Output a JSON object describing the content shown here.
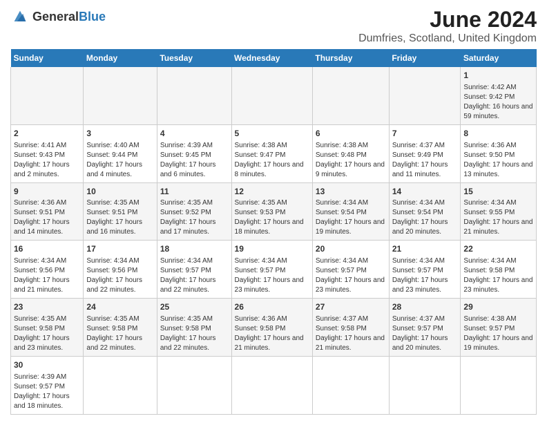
{
  "header": {
    "logo_general": "General",
    "logo_blue": "Blue",
    "title": "June 2024",
    "subtitle": "Dumfries, Scotland, United Kingdom"
  },
  "columns": [
    "Sunday",
    "Monday",
    "Tuesday",
    "Wednesday",
    "Thursday",
    "Friday",
    "Saturday"
  ],
  "weeks": [
    {
      "days": [
        {
          "num": "",
          "detail": ""
        },
        {
          "num": "",
          "detail": ""
        },
        {
          "num": "",
          "detail": ""
        },
        {
          "num": "",
          "detail": ""
        },
        {
          "num": "",
          "detail": ""
        },
        {
          "num": "",
          "detail": ""
        },
        {
          "num": "1",
          "detail": "Sunrise: 4:42 AM\nSunset: 9:42 PM\nDaylight: 16 hours and 59 minutes."
        }
      ]
    },
    {
      "days": [
        {
          "num": "2",
          "detail": "Sunrise: 4:41 AM\nSunset: 9:43 PM\nDaylight: 17 hours and 2 minutes."
        },
        {
          "num": "3",
          "detail": "Sunrise: 4:40 AM\nSunset: 9:44 PM\nDaylight: 17 hours and 4 minutes."
        },
        {
          "num": "4",
          "detail": "Sunrise: 4:39 AM\nSunset: 9:45 PM\nDaylight: 17 hours and 6 minutes."
        },
        {
          "num": "5",
          "detail": "Sunrise: 4:38 AM\nSunset: 9:47 PM\nDaylight: 17 hours and 8 minutes."
        },
        {
          "num": "6",
          "detail": "Sunrise: 4:38 AM\nSunset: 9:48 PM\nDaylight: 17 hours and 9 minutes."
        },
        {
          "num": "7",
          "detail": "Sunrise: 4:37 AM\nSunset: 9:49 PM\nDaylight: 17 hours and 11 minutes."
        },
        {
          "num": "8",
          "detail": "Sunrise: 4:36 AM\nSunset: 9:50 PM\nDaylight: 17 hours and 13 minutes."
        }
      ]
    },
    {
      "days": [
        {
          "num": "9",
          "detail": "Sunrise: 4:36 AM\nSunset: 9:51 PM\nDaylight: 17 hours and 14 minutes."
        },
        {
          "num": "10",
          "detail": "Sunrise: 4:35 AM\nSunset: 9:51 PM\nDaylight: 17 hours and 16 minutes."
        },
        {
          "num": "11",
          "detail": "Sunrise: 4:35 AM\nSunset: 9:52 PM\nDaylight: 17 hours and 17 minutes."
        },
        {
          "num": "12",
          "detail": "Sunrise: 4:35 AM\nSunset: 9:53 PM\nDaylight: 17 hours and 18 minutes."
        },
        {
          "num": "13",
          "detail": "Sunrise: 4:34 AM\nSunset: 9:54 PM\nDaylight: 17 hours and 19 minutes."
        },
        {
          "num": "14",
          "detail": "Sunrise: 4:34 AM\nSunset: 9:54 PM\nDaylight: 17 hours and 20 minutes."
        },
        {
          "num": "15",
          "detail": "Sunrise: 4:34 AM\nSunset: 9:55 PM\nDaylight: 17 hours and 21 minutes."
        }
      ]
    },
    {
      "days": [
        {
          "num": "16",
          "detail": "Sunrise: 4:34 AM\nSunset: 9:56 PM\nDaylight: 17 hours and 21 minutes."
        },
        {
          "num": "17",
          "detail": "Sunrise: 4:34 AM\nSunset: 9:56 PM\nDaylight: 17 hours and 22 minutes."
        },
        {
          "num": "18",
          "detail": "Sunrise: 4:34 AM\nSunset: 9:57 PM\nDaylight: 17 hours and 22 minutes."
        },
        {
          "num": "19",
          "detail": "Sunrise: 4:34 AM\nSunset: 9:57 PM\nDaylight: 17 hours and 23 minutes."
        },
        {
          "num": "20",
          "detail": "Sunrise: 4:34 AM\nSunset: 9:57 PM\nDaylight: 17 hours and 23 minutes."
        },
        {
          "num": "21",
          "detail": "Sunrise: 4:34 AM\nSunset: 9:57 PM\nDaylight: 17 hours and 23 minutes."
        },
        {
          "num": "22",
          "detail": "Sunrise: 4:34 AM\nSunset: 9:58 PM\nDaylight: 17 hours and 23 minutes."
        }
      ]
    },
    {
      "days": [
        {
          "num": "23",
          "detail": "Sunrise: 4:35 AM\nSunset: 9:58 PM\nDaylight: 17 hours and 23 minutes."
        },
        {
          "num": "24",
          "detail": "Sunrise: 4:35 AM\nSunset: 9:58 PM\nDaylight: 17 hours and 22 minutes."
        },
        {
          "num": "25",
          "detail": "Sunrise: 4:35 AM\nSunset: 9:58 PM\nDaylight: 17 hours and 22 minutes."
        },
        {
          "num": "26",
          "detail": "Sunrise: 4:36 AM\nSunset: 9:58 PM\nDaylight: 17 hours and 21 minutes."
        },
        {
          "num": "27",
          "detail": "Sunrise: 4:37 AM\nSunset: 9:58 PM\nDaylight: 17 hours and 21 minutes."
        },
        {
          "num": "28",
          "detail": "Sunrise: 4:37 AM\nSunset: 9:57 PM\nDaylight: 17 hours and 20 minutes."
        },
        {
          "num": "29",
          "detail": "Sunrise: 4:38 AM\nSunset: 9:57 PM\nDaylight: 17 hours and 19 minutes."
        }
      ]
    },
    {
      "days": [
        {
          "num": "30",
          "detail": "Sunrise: 4:39 AM\nSunset: 9:57 PM\nDaylight: 17 hours and 18 minutes."
        },
        {
          "num": "",
          "detail": ""
        },
        {
          "num": "",
          "detail": ""
        },
        {
          "num": "",
          "detail": ""
        },
        {
          "num": "",
          "detail": ""
        },
        {
          "num": "",
          "detail": ""
        },
        {
          "num": "",
          "detail": ""
        }
      ]
    }
  ]
}
